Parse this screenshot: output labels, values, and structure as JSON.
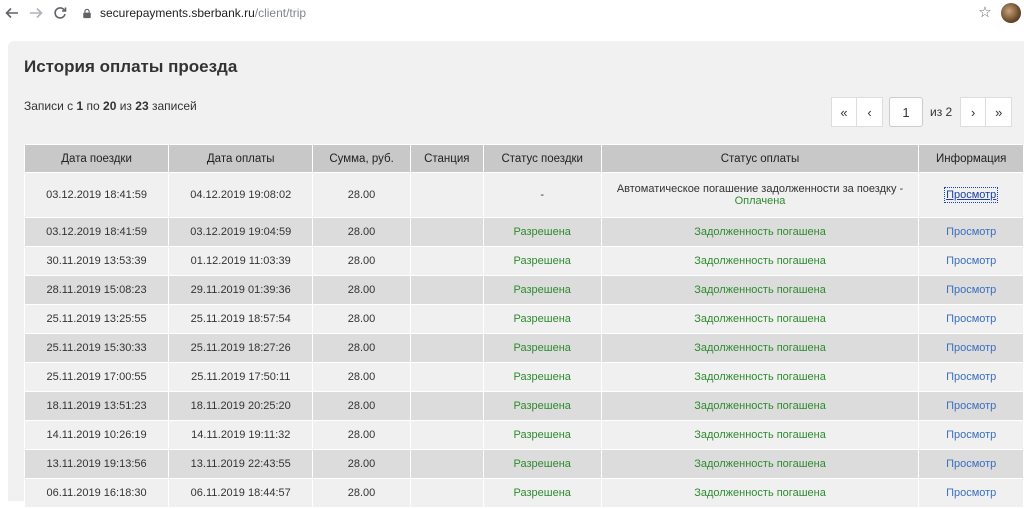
{
  "browser": {
    "url_host": "securepayments.sberbank.ru",
    "url_path": "/client/trip"
  },
  "page": {
    "title": "История оплаты проезда",
    "records": {
      "prefix": "Записи с ",
      "from": "1",
      "mid1": " по ",
      "to": "20",
      "mid2": " из ",
      "total": "23",
      "suffix": " записей"
    }
  },
  "pager": {
    "first": "«",
    "prev": "‹",
    "current": "1",
    "of_text": "из 2",
    "next": "›",
    "last": "»"
  },
  "table": {
    "headers": [
      "Дата поездки",
      "Дата оплаты",
      "Сумма, руб.",
      "Станция",
      "Статус поездки",
      "Статус оплаты",
      "Информация"
    ],
    "rows": [
      {
        "trip_date": "03.12.2019 18:41:59",
        "pay_date": "04.12.2019 19:08:02",
        "amount": "28.00",
        "station": "",
        "trip_status": "-",
        "pay_status_line1": "Автоматическое погашение задолженности за поездку -",
        "pay_status": "Оплачена",
        "info": "Просмотр"
      },
      {
        "trip_date": "03.12.2019 18:41:59",
        "pay_date": "03.12.2019 19:04:59",
        "amount": "28.00",
        "station": "",
        "trip_status": "Разрешена",
        "pay_status": "Задолженность погашена",
        "info": "Просмотр"
      },
      {
        "trip_date": "30.11.2019 13:53:39",
        "pay_date": "01.12.2019 11:03:39",
        "amount": "28.00",
        "station": "",
        "trip_status": "Разрешена",
        "pay_status": "Задолженность погашена",
        "info": "Просмотр"
      },
      {
        "trip_date": "28.11.2019 15:08:23",
        "pay_date": "29.11.2019 01:39:36",
        "amount": "28.00",
        "station": "",
        "trip_status": "Разрешена",
        "pay_status": "Задолженность погашена",
        "info": "Просмотр"
      },
      {
        "trip_date": "25.11.2019 13:25:55",
        "pay_date": "25.11.2019 18:57:54",
        "amount": "28.00",
        "station": "",
        "trip_status": "Разрешена",
        "pay_status": "Задолженность погашена",
        "info": "Просмотр"
      },
      {
        "trip_date": "25.11.2019 15:30:33",
        "pay_date": "25.11.2019 18:27:26",
        "amount": "28.00",
        "station": "",
        "trip_status": "Разрешена",
        "pay_status": "Задолженность погашена",
        "info": "Просмотр"
      },
      {
        "trip_date": "25.11.2019 17:00:55",
        "pay_date": "25.11.2019 17:50:11",
        "amount": "28.00",
        "station": "",
        "trip_status": "Разрешена",
        "pay_status": "Задолженность погашена",
        "info": "Просмотр"
      },
      {
        "trip_date": "18.11.2019 13:51:23",
        "pay_date": "18.11.2019 20:25:20",
        "amount": "28.00",
        "station": "",
        "trip_status": "Разрешена",
        "pay_status": "Задолженность погашена",
        "info": "Просмотр"
      },
      {
        "trip_date": "14.11.2019 10:26:19",
        "pay_date": "14.11.2019 19:11:32",
        "amount": "28.00",
        "station": "",
        "trip_status": "Разрешена",
        "pay_status": "Задолженность погашена",
        "info": "Просмотр"
      },
      {
        "trip_date": "13.11.2019 19:13:56",
        "pay_date": "13.11.2019 22:43:55",
        "amount": "28.00",
        "station": "",
        "trip_status": "Разрешена",
        "pay_status": "Задолженность погашена",
        "info": "Просмотр"
      },
      {
        "trip_date": "06.11.2019 16:18:30",
        "pay_date": "06.11.2019 18:44:57",
        "amount": "28.00",
        "station": "",
        "trip_status": "Разрешена",
        "pay_status": "Задолженность погашена",
        "info": "Просмотр"
      }
    ]
  }
}
